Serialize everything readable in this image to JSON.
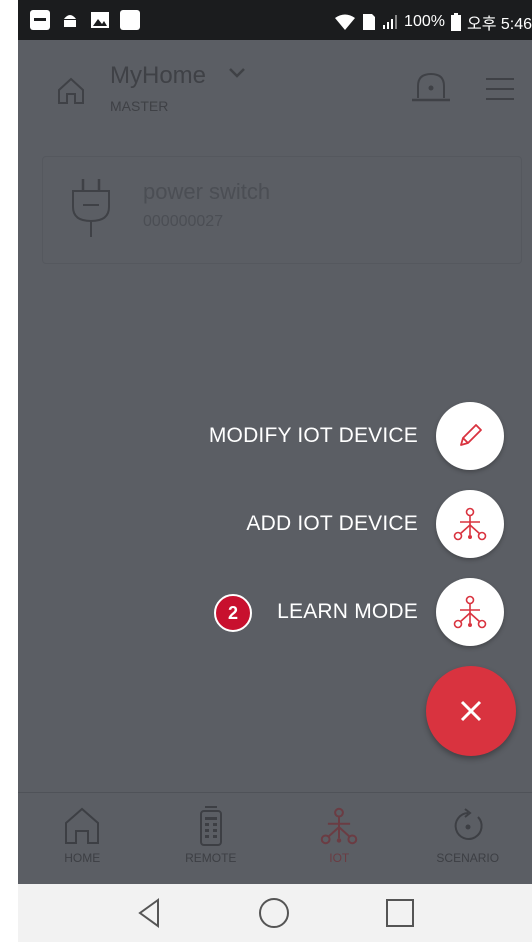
{
  "status_bar": {
    "battery": "100%",
    "time": "오후 5:46"
  },
  "app_bar": {
    "title": "MyHome",
    "subtitle": "MASTER"
  },
  "device_card": {
    "name": "power switch",
    "sub": "000000027"
  },
  "fab_menu": {
    "items": [
      {
        "label": "MODIFY IOT DEVICE",
        "icon": "pencil-icon"
      },
      {
        "label": "ADD IOT DEVICE",
        "icon": "iot-network-icon"
      },
      {
        "label": "LEARN MODE",
        "icon": "iot-network-icon"
      }
    ],
    "step_badge": "2",
    "close_icon": "close-icon"
  },
  "bottom_nav": {
    "items": [
      {
        "label": "HOME",
        "icon": "home-icon"
      },
      {
        "label": "REMOTE",
        "icon": "remote-icon"
      },
      {
        "label": "IOT",
        "icon": "iot-network-icon",
        "active": true
      },
      {
        "label": "SCENARIO",
        "icon": "scenario-icon"
      }
    ]
  },
  "colors": {
    "accent": "#d9333f",
    "badge": "#c8102e",
    "overlay": "#5b5e64"
  }
}
